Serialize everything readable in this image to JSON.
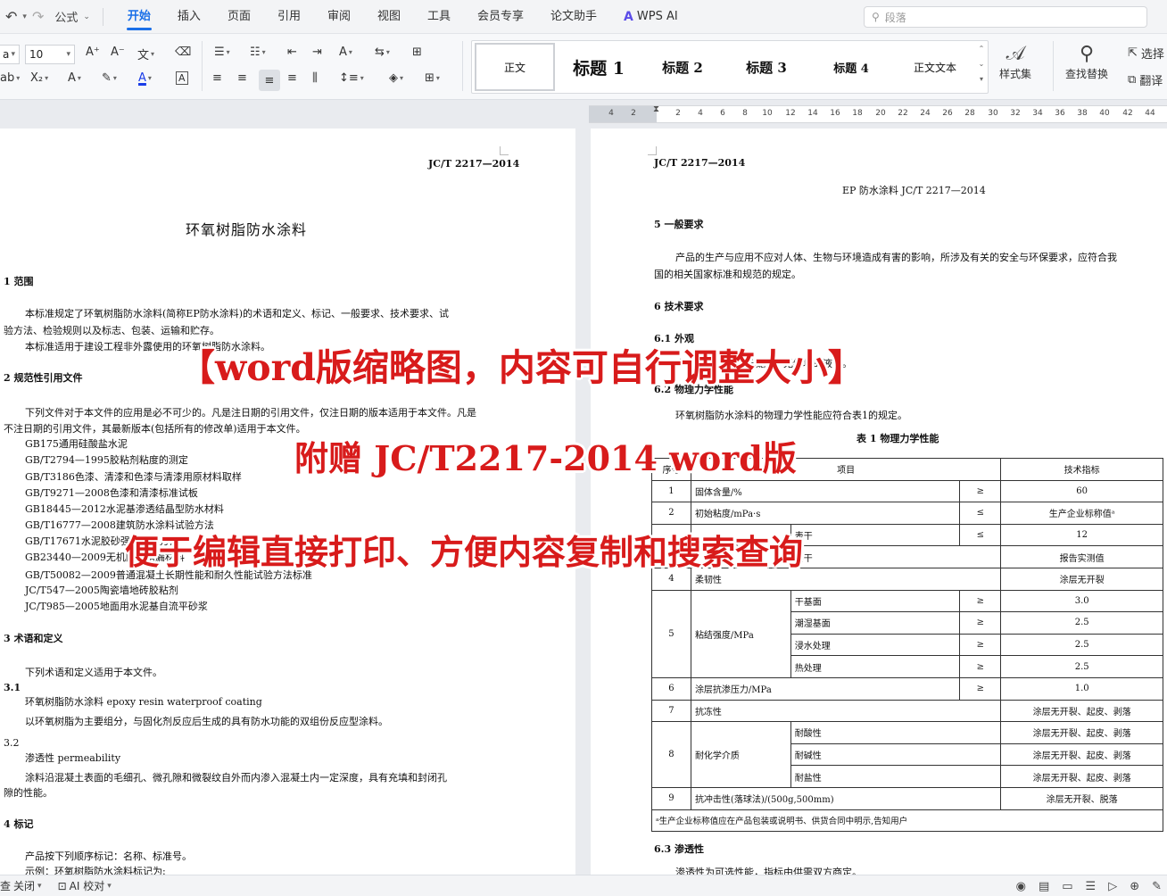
{
  "menubar": {
    "style_label": "公式",
    "tabs": [
      "开始",
      "插入",
      "页面",
      "引用",
      "审阅",
      "视图",
      "工具",
      "会员专享",
      "论文助手"
    ],
    "wps_ai_logo": "A",
    "wps_ai": "WPS AI",
    "search_placeholder": "段落"
  },
  "ribbon": {
    "font_name": "a",
    "font_size": "10",
    "font_color": "#1a3de8",
    "styles": [
      "正文",
      "标题 1",
      "标题 2",
      "标题 3",
      "标题 4",
      "正文文本"
    ],
    "style_set": "样式集",
    "find_replace": "查找替换",
    "select": "选择",
    "translate": "翻译"
  },
  "ruler": {
    "ticks": [
      "4",
      "2",
      "2",
      "4",
      "6",
      "8",
      "10",
      "12",
      "14",
      "16",
      "18",
      "20",
      "22",
      "24",
      "26",
      "28",
      "30",
      "32",
      "34",
      "36",
      "38",
      "40",
      "42",
      "44"
    ]
  },
  "left_page": {
    "header": "JC/T 2217—2014",
    "title": "环氧树脂防水涂料",
    "s1": "1  范围",
    "s1_p1a": "本标准规定了环氧树脂防水涂料(简称EP防水涂料)的术语和定义、标记、一般要求、技术要求、试",
    "s1_p1b": "验方法、检验规则以及标志、包装、运输和贮存。",
    "s1_p2": "本标准适用于建设工程非外露使用的环氧树脂防水涂料。",
    "s2": "2  规范性引用文件",
    "s2_p1a": "下列文件对于本文件的应用是必不可少的。凡是注日期的引用文件，仅注日期的版本适用于本文件。凡是",
    "s2_p1b": "不注日期的引用文件，其最新版本(包括所有的修改单)适用于本文件。",
    "refs": [
      "GB175通用硅酸盐水泥",
      "GB/T2794—1995胶粘剂粘度的测定",
      "GB/T3186色漆、清漆和色漆与清漆用原材料取样",
      "GB/T9271—2008色漆和清漆标准试板",
      "GB18445—2012水泥基渗透结晶型防水材料",
      "GB/T16777—2008建筑防水涂料试验方法",
      "GB/T17671水泥胶砂强度检验方法",
      "GB23440—2009无机防水堵漏材料",
      "GB/T50082—2009普通混凝土长期性能和耐久性能试验方法标准",
      "JC/T547—2005陶瓷墙地砖胶粘剂",
      "JC/T985—2005地面用水泥基自流平砂浆"
    ],
    "s3": "3  术语和定义",
    "s3_p": "下列术语和定义适用于本文件。",
    "s31": "3.1",
    "s31_term": "环氧树脂防水涂料   epoxy resin  waterproof coating",
    "s31_def": "以环氧树脂为主要组分，与固化剂反应后生成的具有防水功能的双组份反应型涂料。",
    "s32": "3.2",
    "s32_term": "渗透性   permeability",
    "s32_def_a": "涂料沿混凝土表面的毛细孔、微孔隙和微裂纹自外而内渗入混凝土内一定深度，具有充填和封闭孔",
    "s32_def_b": "隙的性能。",
    "s4": "4  标记",
    "s4_p": "产品按下列顺序标记：名称、标准号。",
    "s4_ex": "示例：环氧树脂防水涂料标记为:"
  },
  "right_page": {
    "header": "JC/T 2217—2014",
    "mark": "EP  防水涂料   JC/T 2217—2014",
    "s5": "5  一般要求",
    "s5_a": "产品的生产与应用不应对人体、生物与环境造成有害的影响，所涉及有关的安全与环保要求，应符合我",
    "s5_b": "国的相关国家标准和规范的规定。",
    "s6": "6  技术要求",
    "s61": "6.1  外观",
    "s61_p": "产品应为均匀、无凝胶、无结块的液体。",
    "s62": "6.2  物理力学性能",
    "s62_p": "环氧树脂防水涂料的物理力学性能应符合表1的规定。",
    "table_caption": "表 1  物理力学性能",
    "table": {
      "h_no": "序号",
      "h_item": "项目",
      "h_val": "技术指标",
      "r1": [
        "1",
        "固体含量/%",
        "≥",
        "60"
      ],
      "r2": [
        "2",
        "初始粘度/mPa·s",
        "≤",
        "生产企业标称值ᵃ"
      ],
      "r3": [
        "3",
        "干燥时间/h",
        "表干",
        "≤",
        "12"
      ],
      "r3b": [
        "实干",
        "报告实测值"
      ],
      "r4": [
        "4",
        "柔韧性",
        "涂层无开裂"
      ],
      "r5": [
        "5",
        "粘结强度/MPa"
      ],
      "r5_rows": [
        [
          "干基面",
          "≥",
          "3.0"
        ],
        [
          "潮湿基面",
          "≥",
          "2.5"
        ],
        [
          "浸水处理",
          "≥",
          "2.5"
        ],
        [
          "热处理",
          "≥",
          "2.5"
        ]
      ],
      "r6": [
        "6",
        "涂层抗渗压力/MPa",
        "≥",
        "1.0"
      ],
      "r7": [
        "7",
        "抗冻性",
        "涂层无开裂、起皮、剥落"
      ],
      "r8": [
        "8",
        "耐化学介质"
      ],
      "r8_rows": [
        [
          "耐酸性",
          "涂层无开裂、起皮、剥落"
        ],
        [
          "耐碱性",
          "涂层无开裂、起皮、剥落"
        ],
        [
          "耐盐性",
          "涂层无开裂、起皮、剥落"
        ]
      ],
      "r9": [
        "9",
        "抗冲击性(落球法)/(500g,500mm)",
        "涂层无开裂、脱落"
      ],
      "note": "ᵃ生产企业标称值应在产品包装或说明书、供货合同中明示,告知用户"
    },
    "s63": "6.3  渗透性",
    "s63_p": "渗透性为可选性能，指标由供需双方商定。"
  },
  "watermark": {
    "line1": "【word版缩略图，内容可自行调整大小】",
    "line2": "附赠 JC/T2217-2014 word版",
    "line3": "便于编辑直接打印、方便内容复制和搜索查询",
    "color": "#d81b1b"
  },
  "statusbar": {
    "left_a": "查",
    "close": "关闭",
    "ai_check": "AI 校对"
  }
}
